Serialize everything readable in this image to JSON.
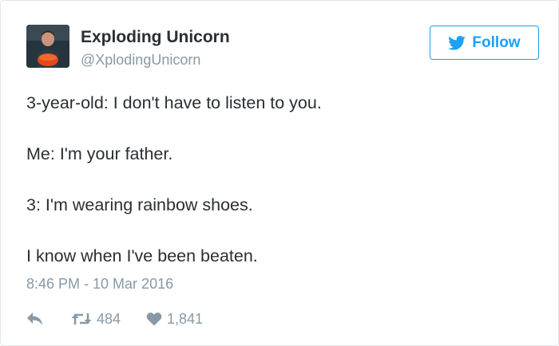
{
  "author": {
    "display_name": "Exploding Unicorn",
    "handle": "@XplodingUnicorn"
  },
  "follow_button": {
    "label": "Follow",
    "icon": "twitter-bird-icon"
  },
  "tweet": {
    "lines": [
      "3-year-old: I don't have to listen to you.",
      "Me: I'm your father.",
      "3: I'm wearing rainbow shoes.",
      "I know when I've been beaten."
    ],
    "timestamp": "8:46 PM - 10 Mar 2016"
  },
  "actions": {
    "reply_icon": "reply-icon",
    "retweet_icon": "retweet-icon",
    "retweet_count": "484",
    "like_icon": "heart-icon",
    "like_count": "1,841"
  },
  "colors": {
    "accent": "#1da1f2",
    "text": "#292f33",
    "muted": "#8899a6",
    "border": "#e1e8ed"
  }
}
